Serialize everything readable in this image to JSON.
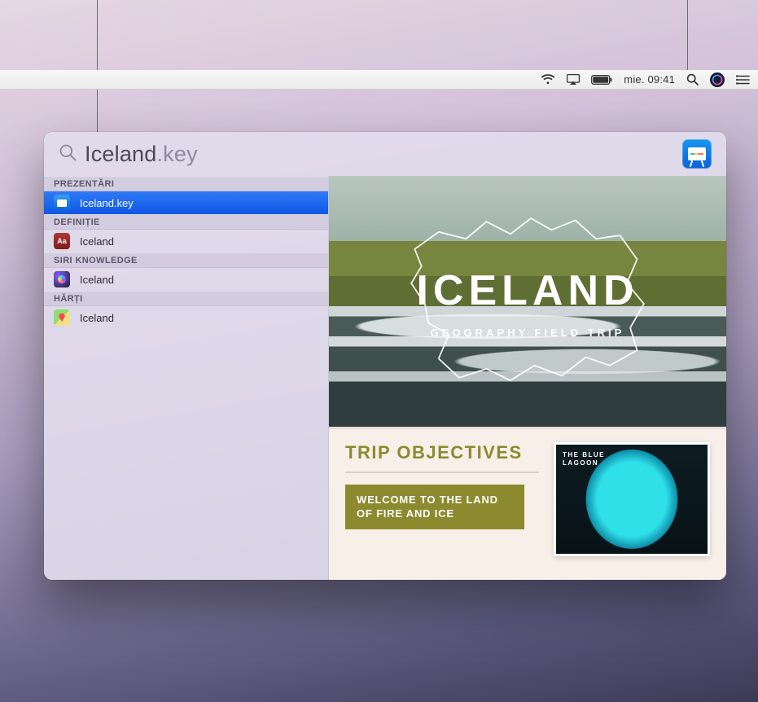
{
  "menubar": {
    "clock": "mie. 09:41"
  },
  "spotlight": {
    "query_main": "Iceland",
    "query_ext": ".key",
    "categories": [
      {
        "name": "PREZENTĂRI",
        "items": [
          {
            "icon": "keynote",
            "label": "Iceland.key",
            "selected": true
          }
        ]
      },
      {
        "name": "DEFINIȚIE",
        "items": [
          {
            "icon": "dictionary",
            "label": "Iceland",
            "selected": false
          }
        ]
      },
      {
        "name": "SIRI KNOWLEDGE",
        "items": [
          {
            "icon": "siri",
            "label": "Iceland",
            "selected": false
          }
        ]
      },
      {
        "name": "HĂRȚI",
        "items": [
          {
            "icon": "maps",
            "label": "Iceland",
            "selected": false
          }
        ]
      }
    ]
  },
  "preview": {
    "slide1_title": "ICELAND",
    "slide1_sub": "GEOGRAPHY FIELD TRIP",
    "slide2_heading": "TRIP OBJECTIVES",
    "slide2_button": "WELCOME TO THE LAND OF FIRE AND ICE",
    "slide2_photo_caption": "THE BLUE\nLAGOON"
  }
}
